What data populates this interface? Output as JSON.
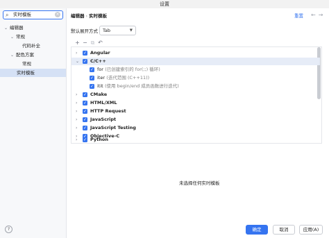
{
  "window": {
    "title": "设置"
  },
  "search": {
    "value": "实时模板",
    "icon": "search-icon",
    "clear_icon": "close-icon"
  },
  "nav": {
    "items": [
      {
        "label": "编辑器",
        "expanded": true
      },
      {
        "label": "常规",
        "expanded": true
      },
      {
        "label": "代码补全"
      },
      {
        "label": "配色方案",
        "expanded": true
      },
      {
        "label": "常规"
      },
      {
        "label": "实时模板",
        "selected": true
      }
    ]
  },
  "header": {
    "breadcrumb": [
      "编辑器",
      "实时模板"
    ],
    "separator": "›",
    "reset_label": "重置",
    "back_icon": "arrow-left-icon",
    "forward_icon": "arrow-right-icon"
  },
  "expand": {
    "label": "默认展开方式",
    "value": "Tab"
  },
  "toolbar": {
    "add": "+",
    "remove": "−",
    "copy": "⧉",
    "undo": "↶"
  },
  "templates": {
    "groups": [
      {
        "name": "Angular",
        "expanded": false,
        "checked": true
      },
      {
        "name": "C/C++",
        "expanded": true,
        "checked": true,
        "items": [
          {
            "abbr": "for",
            "desc": "(已创建索引的 for(;;) 循环)",
            "checked": true
          },
          {
            "abbr": "iter",
            "desc": "(迭代范围 (C++11))",
            "checked": true
          },
          {
            "abbr": "itit",
            "desc": "(使用 begin/end 成员函数进行迭代)",
            "checked": true
          }
        ]
      },
      {
        "name": "CMake",
        "expanded": false,
        "checked": true
      },
      {
        "name": "HTML/XML",
        "expanded": false,
        "checked": true
      },
      {
        "name": "HTTP Request",
        "expanded": false,
        "checked": true
      },
      {
        "name": "JavaScript",
        "expanded": false,
        "checked": true
      },
      {
        "name": "JavaScript Testing",
        "expanded": false,
        "checked": true
      },
      {
        "name": "Objective-C",
        "expanded": false,
        "checked": true
      },
      {
        "name": "Python",
        "expanded": false,
        "checked": true
      }
    ]
  },
  "empty_text": "未选择任何实时模板",
  "footer": {
    "help": "?",
    "ok_label": "确定",
    "cancel_label": "取消",
    "apply_label": "应用(A)"
  },
  "colors": {
    "accent": "#3574f0",
    "selection": "#d5e1f5",
    "sidebar_bg": "#f7f8fa"
  }
}
